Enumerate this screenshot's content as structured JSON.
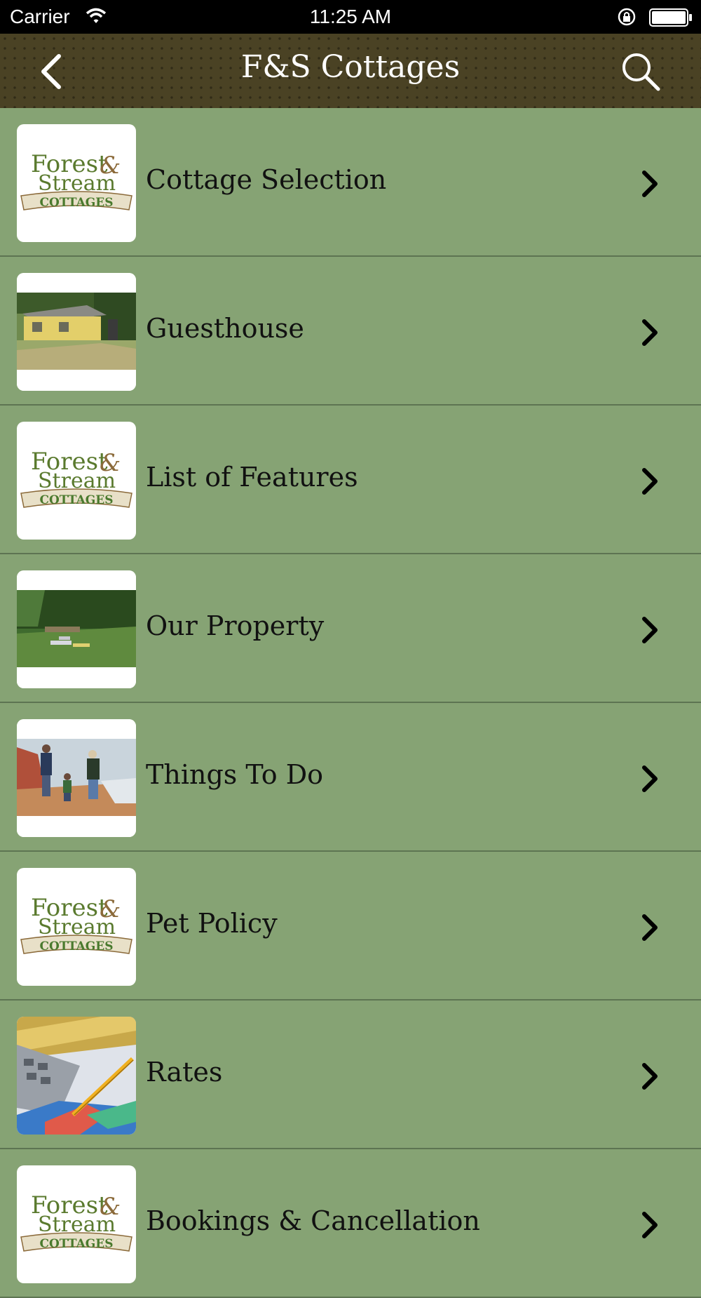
{
  "status_bar": {
    "carrier": "Carrier",
    "time": "11:25 AM"
  },
  "nav": {
    "title": "F&S Cottages"
  },
  "logo_text": {
    "line1": "Forest",
    "line2": "Stream",
    "ampersand": "&",
    "line3": "COTTAGES"
  },
  "menu": [
    {
      "label": "Cottage Selection",
      "thumb": "logo"
    },
    {
      "label": "Guesthouse",
      "thumb": "guesthouse-photo"
    },
    {
      "label": "List of Features",
      "thumb": "logo"
    },
    {
      "label": "Our Property",
      "thumb": "property-photo"
    },
    {
      "label": "Things To Do",
      "thumb": "beach-photo"
    },
    {
      "label": "Pet Policy",
      "thumb": "logo"
    },
    {
      "label": "Rates",
      "thumb": "calculator-photo"
    },
    {
      "label": "Bookings & Cancellation",
      "thumb": "logo"
    }
  ],
  "colors": {
    "background": "#86a374",
    "navbar": "#4a4224",
    "divider": "#5d7452"
  }
}
